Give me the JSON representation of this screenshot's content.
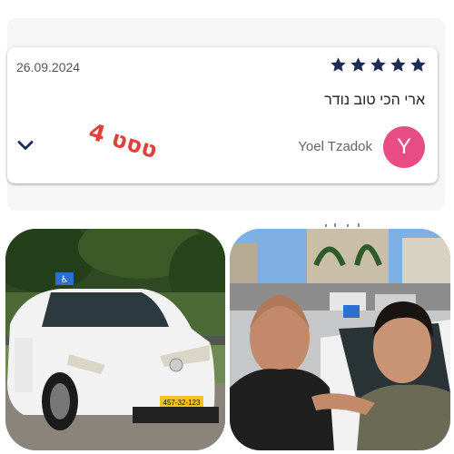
{
  "review": {
    "date": "26.09.2024",
    "rating": 5,
    "text": "ארי הכי טוב נודר",
    "reviewer_name": "Yoel Tzadok",
    "avatar_initial": "Y",
    "avatar_color": "#e94c82",
    "star_color": "#1c2c55",
    "handwritten_note": "טסט 4"
  },
  "photos": {
    "left": {
      "plate": "457-32-123"
    }
  },
  "icons": {
    "expand": "chevron-down-icon",
    "stars": "star-icon"
  }
}
